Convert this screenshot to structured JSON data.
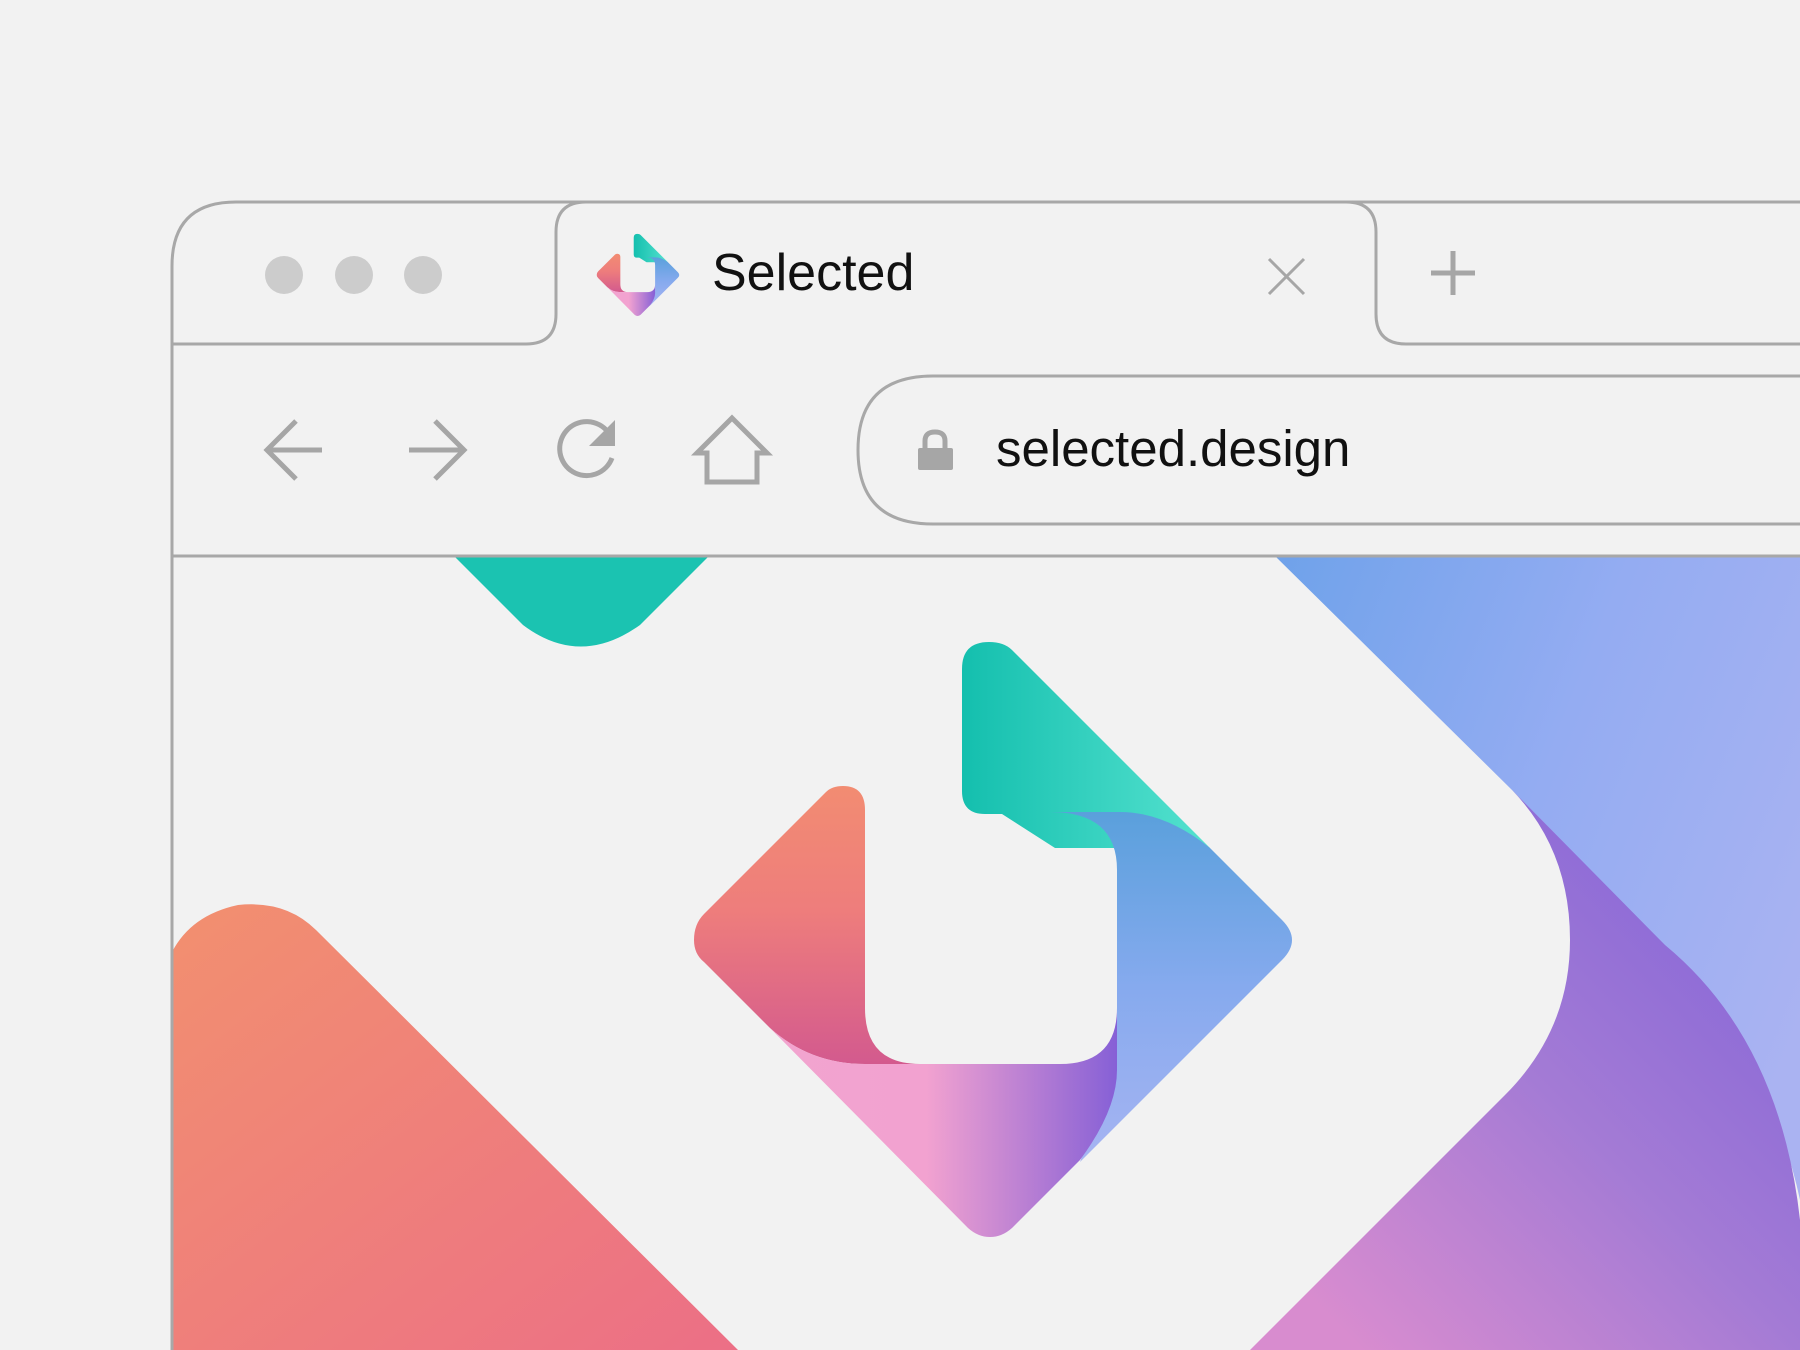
{
  "window": {
    "controls": [
      "close-dot",
      "minimize-dot",
      "maximize-dot"
    ]
  },
  "tab": {
    "title": "Selected",
    "close_icon": "close-icon",
    "favicon": "selected-logo-icon"
  },
  "new_tab": {
    "icon": "plus-icon"
  },
  "toolbar": {
    "back_icon": "arrow-left-icon",
    "forward_icon": "arrow-right-icon",
    "reload_icon": "reload-icon",
    "home_icon": "home-icon"
  },
  "address_bar": {
    "url": "selected.design",
    "lock_icon": "lock-icon"
  },
  "colors": {
    "chrome_background": "#f2f2f2",
    "chrome_line": "#a8a8a8",
    "icon_gray": "#a6a6a6",
    "teal": "#1bc3b1",
    "coral": "#f18a74",
    "blue": "#7ea7ec",
    "violet": "#8a66d8",
    "pink": "#f2a2d0"
  }
}
